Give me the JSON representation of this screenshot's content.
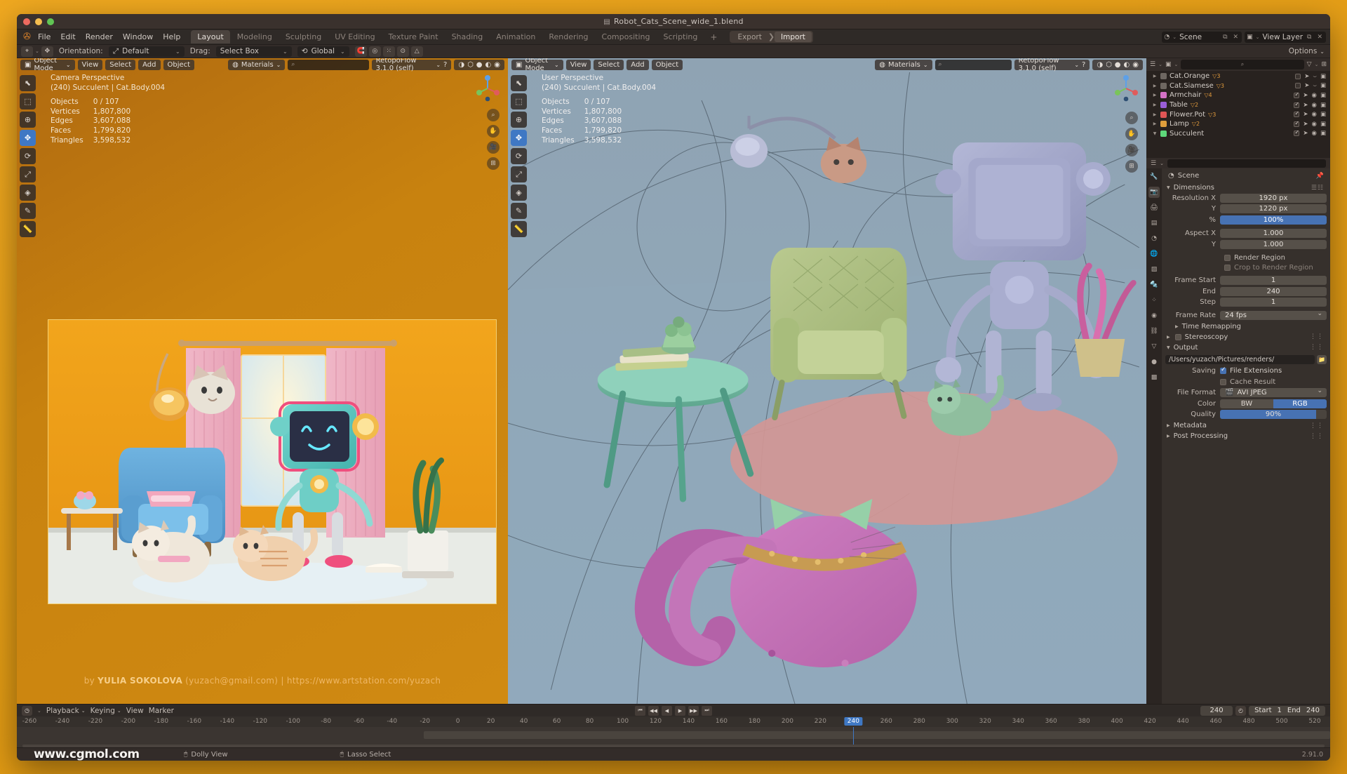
{
  "window": {
    "title": "Robot_Cats_Scene_wide_1.blend"
  },
  "topbar": {
    "menus": [
      "File",
      "Edit",
      "Render",
      "Window",
      "Help"
    ],
    "tabs": [
      "Layout",
      "Modeling",
      "Sculpting",
      "UV Editing",
      "Texture Paint",
      "Shading",
      "Animation",
      "Rendering",
      "Compositing",
      "Scripting"
    ],
    "active_tab": "Layout",
    "add_tab": "+",
    "export_label": "Export",
    "import_label": "Import",
    "scene_name": "Scene",
    "view_layer_name": "View Layer"
  },
  "toolrow": {
    "orientation_label": "Orientation:",
    "orientation_value": "Default",
    "drag_label": "Drag:",
    "drag_value": "Select Box",
    "transform_value": "Global",
    "options_label": "Options"
  },
  "viewport_left": {
    "mode": "Object Mode",
    "menus": [
      "View",
      "Select",
      "Add",
      "Object"
    ],
    "material_mode": "Materials",
    "search_placeholder": "",
    "addon": "RetopoFlow 3.1.0 (self)",
    "stats": {
      "view_name": "Camera Perspective",
      "selection": "(240) Succulent | Cat.Body.004",
      "rows": [
        {
          "key": "Objects",
          "value": "0 / 107"
        },
        {
          "key": "Vertices",
          "value": "1,807,800"
        },
        {
          "key": "Edges",
          "value": "3,607,088"
        },
        {
          "key": "Faces",
          "value": "1,799,820"
        },
        {
          "key": "Triangles",
          "value": "3,598,532"
        }
      ]
    },
    "watermark_by": "by",
    "watermark_name": "YULIA SOKOLOVA",
    "watermark_email": "(yuzach@gmail.com)",
    "watermark_sep": "|",
    "watermark_url": "https://www.artstation.com/yuzach"
  },
  "viewport_right": {
    "mode": "Object Mode",
    "menus": [
      "View",
      "Select",
      "Add",
      "Object"
    ],
    "material_mode": "Materials",
    "addon": "RetopoFlow 3.1.0 (self)",
    "stats": {
      "view_name": "User Perspective",
      "selection": "(240) Succulent | Cat.Body.004",
      "rows": [
        {
          "key": "Objects",
          "value": "0 / 107"
        },
        {
          "key": "Vertices",
          "value": "1,807,800"
        },
        {
          "key": "Edges",
          "value": "3,607,088"
        },
        {
          "key": "Faces",
          "value": "1,799,820"
        },
        {
          "key": "Triangles",
          "value": "3,598,532"
        }
      ]
    }
  },
  "outliner": {
    "items": [
      {
        "name": "Cat.Orange",
        "color": "#6e6761",
        "disabled": true,
        "expanded": false,
        "mod": "3",
        "checked": false
      },
      {
        "name": "Cat.Siamese",
        "color": "#6e6761",
        "disabled": true,
        "expanded": false,
        "mod": "3",
        "checked": false
      },
      {
        "name": "Armchair",
        "color": "#d471c6",
        "disabled": false,
        "expanded": false,
        "mod": "4",
        "checked": true
      },
      {
        "name": "Table",
        "color": "#9a5ed8",
        "disabled": false,
        "expanded": false,
        "mod": "2",
        "checked": true
      },
      {
        "name": "Flower.Pot",
        "color": "#e05555",
        "disabled": false,
        "expanded": false,
        "mod": "3",
        "checked": true
      },
      {
        "name": "Lamp",
        "color": "#e09e3c",
        "disabled": false,
        "expanded": false,
        "mod": "2",
        "checked": true
      },
      {
        "name": "Succulent",
        "color": "#5ed87a",
        "disabled": false,
        "expanded": true,
        "mod": "",
        "checked": true
      }
    ]
  },
  "properties": {
    "breadcrumb": "Scene",
    "sections": {
      "dimensions": {
        "title": "Dimensions",
        "fields": [
          {
            "label": "Resolution X",
            "value": "1920 px",
            "style": "normal"
          },
          {
            "label": "Y",
            "value": "1220 px",
            "style": "normal"
          },
          {
            "label": "%",
            "value": "100%",
            "style": "blue"
          },
          {
            "label": "Aspect X",
            "value": "1.000",
            "style": "normal"
          },
          {
            "label": "Y",
            "value": "1.000",
            "style": "normal"
          }
        ],
        "checks": [
          {
            "label": "Render Region",
            "checked": false,
            "dim": false
          },
          {
            "label": "Crop to Render Region",
            "checked": false,
            "dim": true
          }
        ],
        "frames": [
          {
            "label": "Frame Start",
            "value": "1",
            "style": "normal"
          },
          {
            "label": "End",
            "value": "240",
            "style": "normal"
          },
          {
            "label": "Step",
            "value": "1",
            "style": "normal"
          }
        ],
        "frame_rate_label": "Frame Rate",
        "frame_rate_value": "24 fps"
      },
      "time_remapping": "Time Remapping",
      "stereoscopy": "Stereoscopy",
      "output": {
        "title": "Output",
        "path": "/Users/yuzach/Pictures/renders/",
        "saving_label": "Saving",
        "file_extensions": "File Extensions",
        "file_extensions_checked": true,
        "cache_result": "Cache Result",
        "cache_result_checked": false,
        "file_format_label": "File Format",
        "file_format_value": "AVI JPEG",
        "color_label": "Color",
        "color_options": [
          "BW",
          "RGB"
        ],
        "color_selected": "RGB",
        "quality_label": "Quality",
        "quality_value": "90%",
        "quality_pct": 90
      },
      "metadata": "Metadata",
      "post_processing": "Post Processing"
    }
  },
  "timeline": {
    "menus": [
      "Playback",
      "Keying",
      "View",
      "Marker"
    ],
    "current_frame": "240",
    "start_label": "Start",
    "start_value": "1",
    "end_label": "End",
    "end_value": "240",
    "ticks": [
      "-260",
      "-240",
      "-220",
      "-200",
      "-180",
      "-160",
      "-140",
      "-120",
      "-100",
      "-80",
      "-60",
      "-40",
      "-20",
      "0",
      "20",
      "40",
      "60",
      "80",
      "100",
      "120",
      "140",
      "160",
      "180",
      "200",
      "220",
      "240",
      "260",
      "280",
      "300",
      "320",
      "340",
      "360",
      "380",
      "400",
      "420",
      "440",
      "460",
      "480",
      "500",
      "520"
    ],
    "playhead_label": "240"
  },
  "status": {
    "watermark": "www.cgmol.com",
    "items": [
      "Dolly View",
      "Lasso Select"
    ],
    "version": "2.91.0"
  },
  "colors": {
    "accent_blue": "#4772b3",
    "orange": "#e8892a",
    "panel_bg": "#36302c"
  }
}
